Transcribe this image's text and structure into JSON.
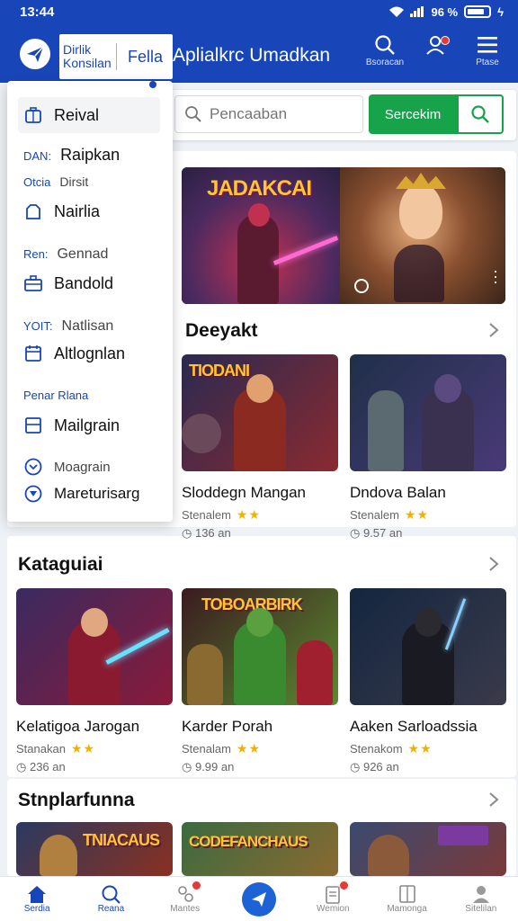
{
  "status_bar": {
    "time": "13:44",
    "signal_text": "96 %"
  },
  "app_bar": {
    "brand_text": "Dirlik Konsilan",
    "brand_tab": "Fella",
    "title": "Aplialkrc Umadkan",
    "search_label": "Bsoracan",
    "menu_label": "Ptase"
  },
  "search": {
    "placeholder": "Pencaaban",
    "button_label": "Sercekim"
  },
  "drawer": {
    "items": [
      {
        "label": "Reival",
        "icon": "briefcase-icon"
      },
      {
        "group": "DAN:",
        "label": "Raipkan"
      },
      {
        "group": "Otcia",
        "sub": "Dirsit"
      },
      {
        "label": "Nairlia",
        "icon": "bag-icon"
      },
      {
        "group": "Ren:",
        "sub": "Gennad"
      },
      {
        "label": "Bandold",
        "icon": "toolbox-icon"
      },
      {
        "group": "YOIT:",
        "sub": "Natlisan"
      },
      {
        "label": "Altlognlan",
        "icon": "calendar-icon"
      },
      {
        "group": "Penar Rlana"
      },
      {
        "label": "Mailgrain",
        "icon": "window-icon"
      },
      {
        "group": "Moagrain",
        "icon": "chevron-circle-icon"
      },
      {
        "label": "Mareturisarg",
        "icon": "play-circle-icon"
      }
    ]
  },
  "hero": {
    "title": "JADAKCAI"
  },
  "sections": [
    {
      "title": "Deeyakt",
      "games": [
        {
          "thumb_title": "TIODANI",
          "name": "Sloddegn Mangan",
          "meta": "Stenalem",
          "stars": "★★",
          "downloads": "136 an",
          "colors": [
            "#2a2a50",
            "#8a2a30"
          ]
        },
        {
          "thumb_title": "",
          "name": "Dndova Balan",
          "meta": "Stenalem",
          "stars": "★★",
          "downloads": "9.57 an",
          "colors": [
            "#1f3048",
            "#4a3a78"
          ]
        }
      ]
    },
    {
      "title": "Kataguiai",
      "games": [
        {
          "thumb_title": "",
          "name": "Kelatigoa Jarogan",
          "meta": "Stanakan",
          "stars": "★★",
          "downloads": "236 an",
          "colors": [
            "#3a2a60",
            "#8a1a3a"
          ]
        },
        {
          "thumb_title": "TOBOARBIRK",
          "name": "Karder Porah",
          "meta": "Stenalam",
          "stars": "★★",
          "downloads": "9.99 an",
          "colors": [
            "#3a1a20",
            "#5a8a30"
          ]
        },
        {
          "thumb_title": "",
          "name": "Aaken Sarloadssia",
          "meta": "Stenakom",
          "stars": "★★",
          "downloads": "926 an",
          "colors": [
            "#142640",
            "#3a3a4a"
          ]
        }
      ]
    },
    {
      "title": "Stnplarfunna",
      "games": [
        {
          "thumb_title": "TNIACAUS",
          "colors": [
            "#2a3a60",
            "#8a3020"
          ]
        },
        {
          "thumb_title": "CODEFANCHAUS",
          "colors": [
            "#3a6a40",
            "#8a6a30"
          ]
        },
        {
          "thumb_title": "",
          "colors": [
            "#3a4a70",
            "#7a3a3a"
          ]
        }
      ]
    }
  ],
  "bottom_nav": [
    {
      "label": "Serdia",
      "icon": "home-icon"
    },
    {
      "label": "Reana",
      "icon": "search-icon"
    },
    {
      "label": "Mantes",
      "icon": "people-icon"
    },
    {
      "label": "",
      "icon": "send-icon"
    },
    {
      "label": "Wemion",
      "icon": "clipboard-icon"
    },
    {
      "label": "Mamonga",
      "icon": "tablet-icon"
    },
    {
      "label": "Sitelilan",
      "icon": "person-icon"
    }
  ],
  "colors": {
    "primary": "#1846b8",
    "accent_green": "#17a34a",
    "star": "#f2b000",
    "badge": "#e53935"
  }
}
